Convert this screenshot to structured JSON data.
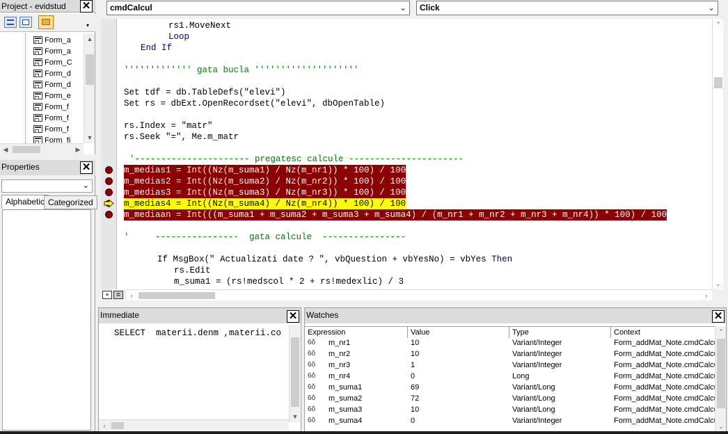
{
  "project": {
    "title": "Project - evidstud",
    "items": [
      "Form_a",
      "Form_a",
      "Form_C",
      "Form_d",
      "Form_d",
      "Form_e",
      "Form_f",
      "Form_f",
      "Form_f",
      "Form_fi"
    ]
  },
  "properties": {
    "title": "Properties",
    "tab_alphabetic": "Alphabetic",
    "tab_categorized": "Categorized"
  },
  "editor": {
    "object_combo": "cmdCalcul",
    "proc_combo": "Click"
  },
  "code": {
    "line1": "rs1.MoveNext",
    "line2": "Loop",
    "line3_kw": "End If",
    "line4": "''''''''''''' gata bucla ''''''''''''''''''''",
    "line5": "Set tdf = db.TableDefs(\"elevi\")",
    "line6": "Set rs = dbExt.OpenRecordset(\"elevi\", dbOpenTable)",
    "line7": "rs.Index = \"matr\"",
    "line8": "rs.Seek \"=\", Me.m_matr",
    "line9": "'---------------------- pregatesc calcule ----------------------",
    "bp1": "m_medias1 = Int((Nz(m_suma1) / Nz(m_nr1)) * 100) / 100",
    "bp2": "m_medias2 = Int((Nz(m_suma2) / Nz(m_nr2)) * 100) / 100",
    "bp3": "m_medias3 = Int((Nz(m_suma3) / Nz(m_nr3)) * 100) / 100",
    "bp4": "m_medias4 = Int((Nz(m_suma4) / Nz(m_nr4)) * 100) / 100",
    "bp5": "m_mediaan = Int(((m_suma1 + m_suma2 + m_suma3 + m_suma4) / (m_nr1 + m_nr2 + m_nr3 + m_nr4)) * 100) / 100",
    "line10": "'     ----------------  gata calcule  ----------------",
    "line11_a": "If MsgBox(\" Actualizati date ? \", vbQuestion + vbYesNo) = vbYes ",
    "line11_b": "Then",
    "line12": "rs.Edit",
    "line13": "m_suma1 = (rs!medscol * 2 + rs!medexlic) / 3"
  },
  "immediate": {
    "title": "Immediate",
    "text": "SELECT  materii.denm ,materii.co"
  },
  "watches": {
    "title": "Watches",
    "headers": [
      "Expression",
      "Value",
      "Type",
      "Context"
    ],
    "rows": [
      {
        "expr": "m_nr1",
        "value": "10",
        "type": "Variant/Integer",
        "context": "Form_addMat_Note.cmdCalcul"
      },
      {
        "expr": "m_nr2",
        "value": "10",
        "type": "Variant/Integer",
        "context": "Form_addMat_Note.cmdCalcul"
      },
      {
        "expr": "m_nr3",
        "value": "1",
        "type": "Variant/Integer",
        "context": "Form_addMat_Note.cmdCalcul"
      },
      {
        "expr": "m_nr4",
        "value": "0",
        "type": "Long",
        "context": "Form_addMat_Note.cmdCalcul"
      },
      {
        "expr": "m_suma1",
        "value": "69",
        "type": "Variant/Long",
        "context": "Form_addMat_Note.cmdCalcul"
      },
      {
        "expr": "m_suma2",
        "value": "72",
        "type": "Variant/Long",
        "context": "Form_addMat_Note.cmdCalcul"
      },
      {
        "expr": "m_suma3",
        "value": "10",
        "type": "Variant/Long",
        "context": "Form_addMat_Note.cmdCalcul"
      },
      {
        "expr": "m_suma4",
        "value": "0",
        "type": "Variant/Integer",
        "context": "Form_addMat_Note.cmdCalcul"
      }
    ],
    "glasses_icon": "watch-glasses-icon"
  },
  "colors": {
    "breakpoint": "#8b0000",
    "current_line": "#ffff00",
    "keyword": "#00008b",
    "comment": "#008000"
  }
}
